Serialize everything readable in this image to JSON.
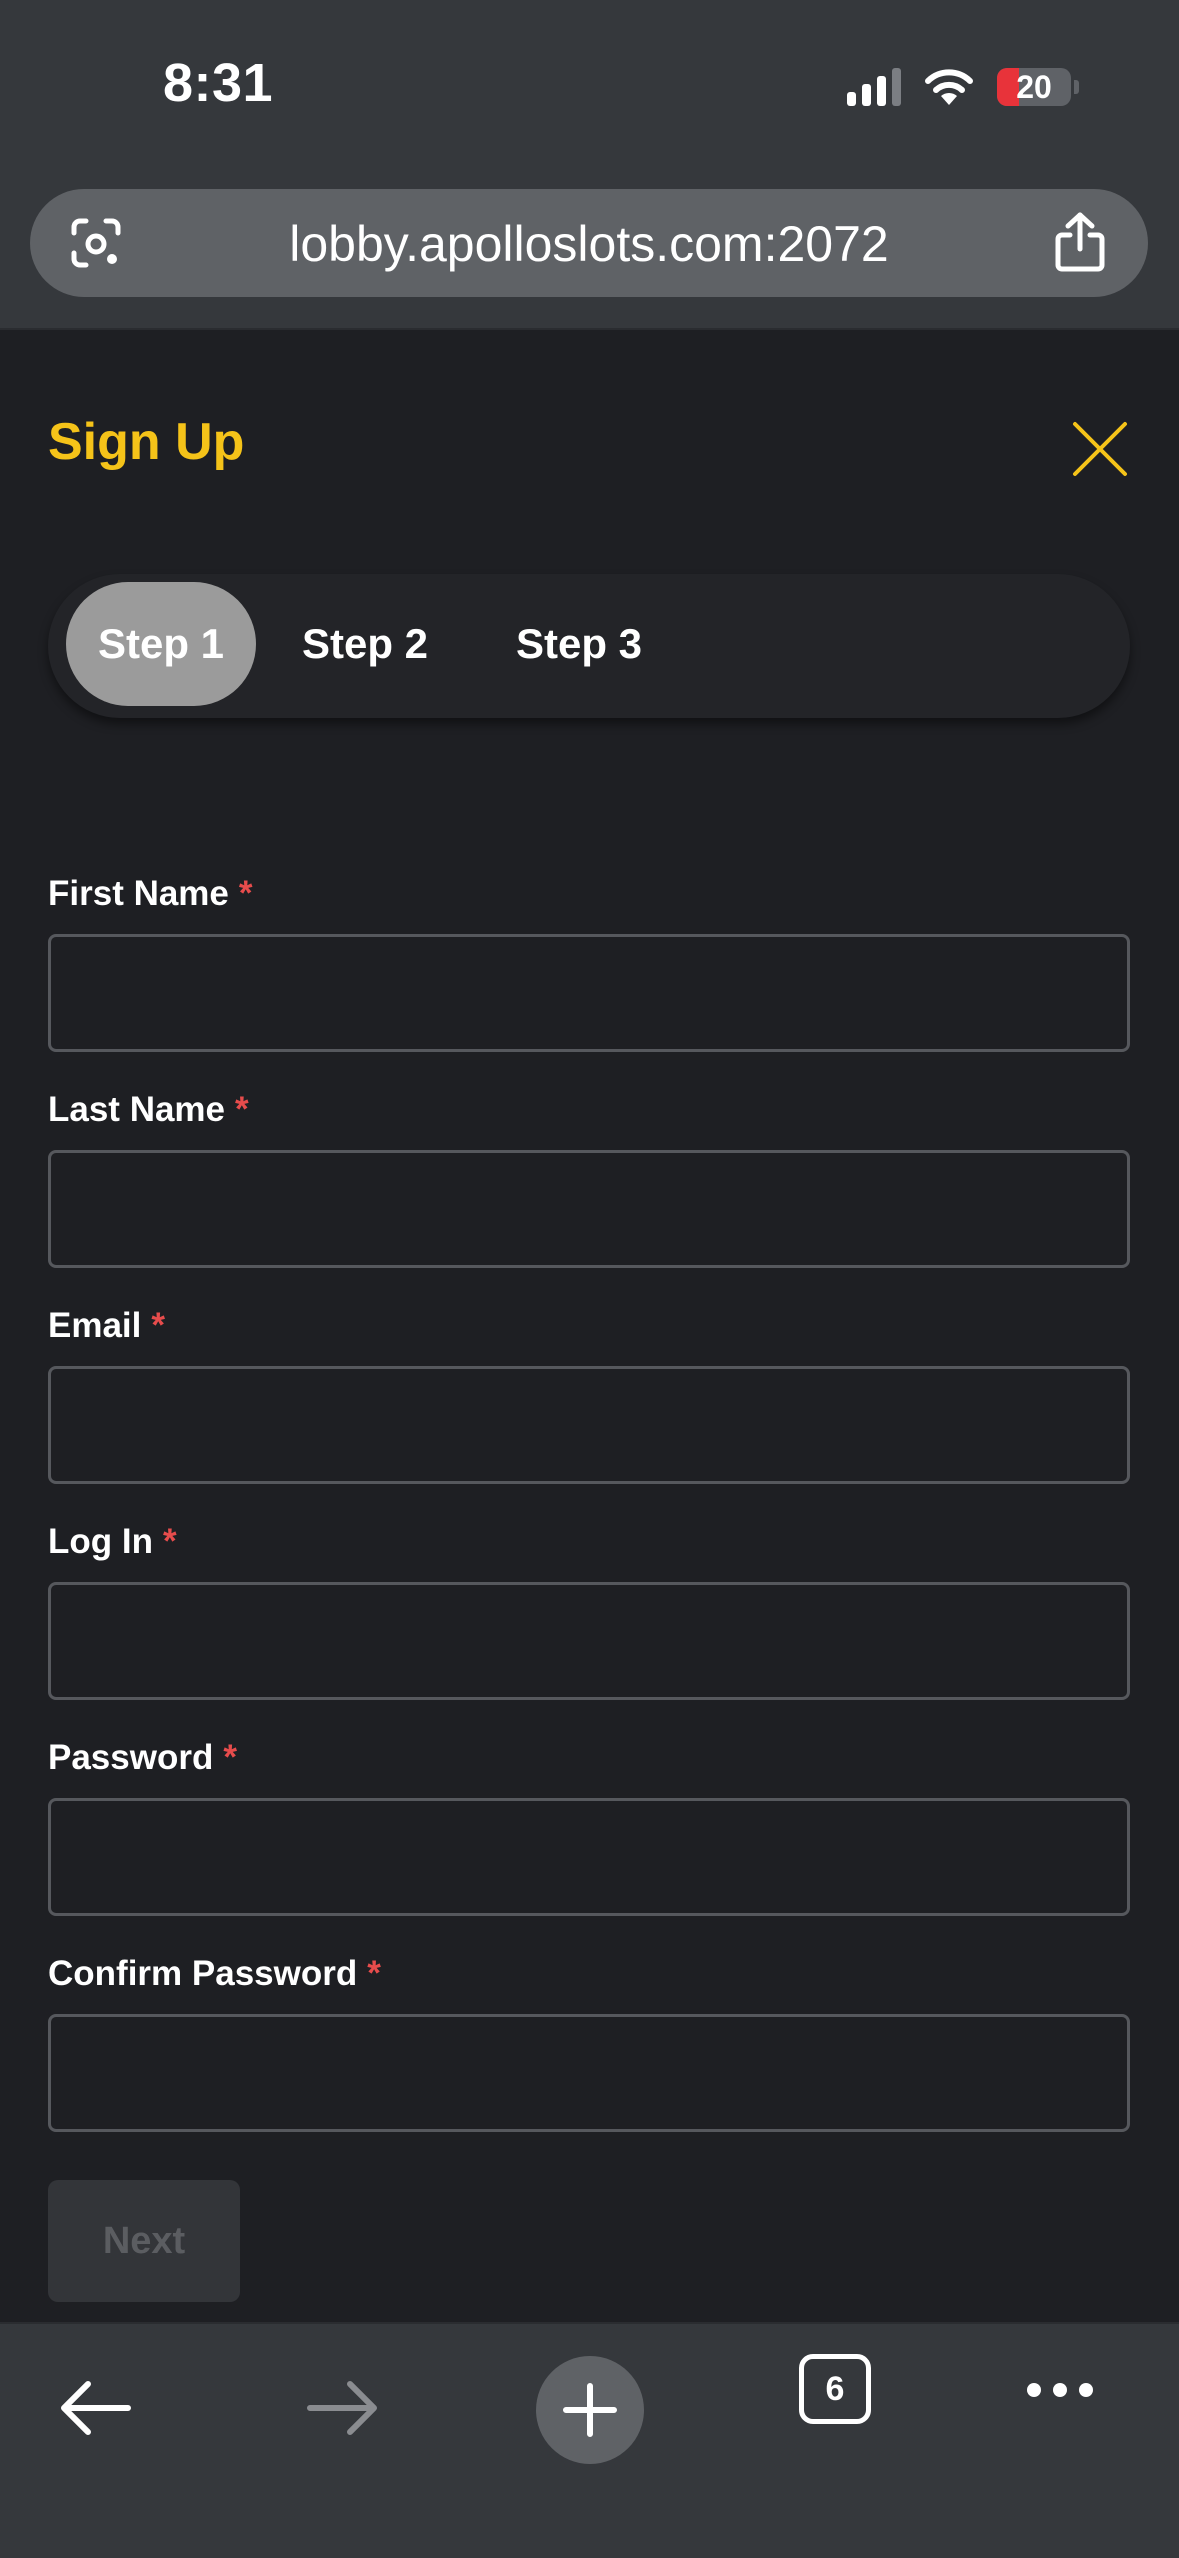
{
  "status_bar": {
    "time": "8:31",
    "battery_level": "20"
  },
  "browser": {
    "url": "lobby.apolloslots.com:2072",
    "tab_count": "6"
  },
  "header": {
    "title": "Sign Up"
  },
  "steps": [
    {
      "label": "Step 1",
      "active": true
    },
    {
      "label": "Step 2",
      "active": false
    },
    {
      "label": "Step 3",
      "active": false
    }
  ],
  "form": {
    "required_marker": "*",
    "fields": [
      {
        "label": "First Name",
        "value": ""
      },
      {
        "label": "Last Name",
        "value": ""
      },
      {
        "label": "Email",
        "value": ""
      },
      {
        "label": "Log In",
        "value": ""
      },
      {
        "label": "Password",
        "value": ""
      },
      {
        "label": "Confirm Password",
        "value": ""
      }
    ],
    "next_label": "Next"
  },
  "colors": {
    "accent": "#f5c319",
    "required": "#e74c4c",
    "background": "#1e1f23",
    "chrome": "#35383c"
  },
  "icons": {
    "lens": "google-lens-icon",
    "share": "share-icon",
    "close": "close-icon",
    "back": "arrow-left-icon",
    "forward": "arrow-right-icon",
    "new_tab": "plus-icon",
    "more": "more-horizontal-icon"
  }
}
